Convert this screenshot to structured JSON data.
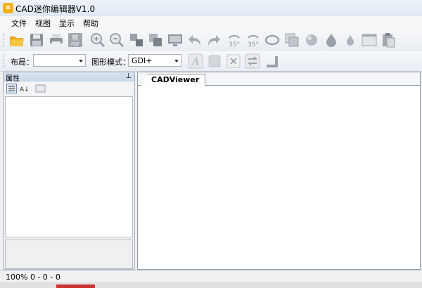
{
  "window": {
    "title": "CAD迷你编辑器V1.0",
    "app_icon_text": "α"
  },
  "menubar": {
    "items": [
      "文件",
      "视图",
      "显示",
      "帮助"
    ]
  },
  "toolbar1": {
    "icons": [
      "open-folder-icon",
      "save-icon",
      "print-icon",
      "convert-pdf-icon",
      "zoom-in-icon",
      "zoom-out-icon",
      "move-icon",
      "copy-icon",
      "screen-icon",
      "undo-icon",
      "redo-icon",
      "rotate-35-left-icon",
      "rotate-35-right-icon",
      "rotate-loop-icon",
      "copy-layers-icon",
      "sphere-icon",
      "drop-icon",
      "drop-small-icon",
      "window-icon",
      "paste-icon"
    ],
    "convert_label": "转",
    "pdf_label": "PDF",
    "rotate_label": "35°"
  },
  "toolbar2": {
    "layout_label": "布局：",
    "layout_value": "",
    "graphics_mode_label": "图形模式：",
    "graphics_mode_value": "GDI+",
    "text_tool_label": "A"
  },
  "properties_panel": {
    "title": "属性",
    "sort_label": "A↓"
  },
  "tabs": [
    {
      "label": "CADViewer"
    }
  ],
  "status": {
    "text": "100%  0 - 0 - 0"
  },
  "colors": {
    "folder": "#f3b21b",
    "icon_gray": "#9aa0a8",
    "accent": "#c33"
  }
}
